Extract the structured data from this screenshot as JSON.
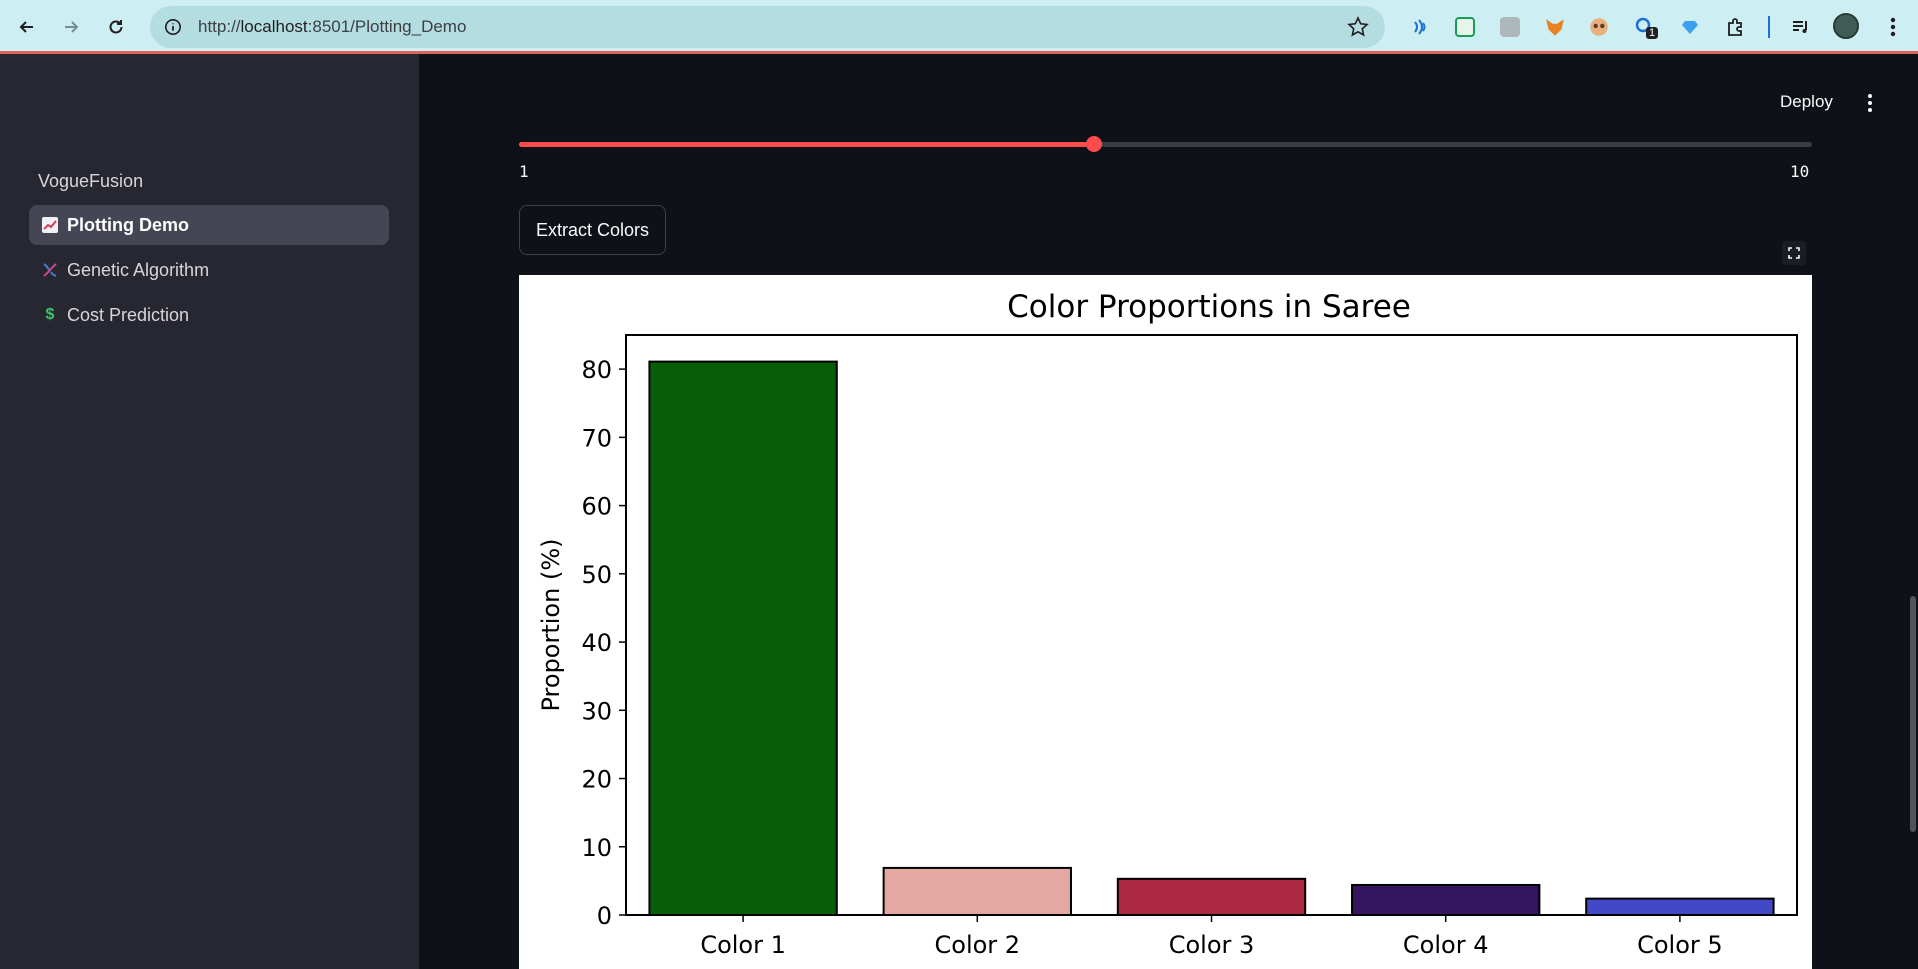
{
  "browser": {
    "url_prefix": "http://",
    "url_host": "localhost",
    "url_rest": ":8501/Plotting_Demo",
    "extension_badge": "1"
  },
  "sidebar": {
    "app_name": "VogueFusion",
    "items": [
      {
        "label": "Plotting Demo",
        "icon": "chart-increasing-icon",
        "active": true
      },
      {
        "label": "Genetic Algorithm",
        "icon": "dna-icon",
        "active": false
      },
      {
        "label": "Cost Prediction",
        "icon": "dollar-icon",
        "active": false
      }
    ]
  },
  "header": {
    "deploy_label": "Deploy"
  },
  "slider": {
    "min_label": "1",
    "max_label": "10",
    "min": 1,
    "max": 10,
    "value": 5,
    "accent": "#ff4b4b"
  },
  "extract_button_label": "Extract Colors",
  "chart_data": {
    "type": "bar",
    "title": "Color Proportions in Saree",
    "xlabel": "",
    "ylabel": "Proportion (%)",
    "categories": [
      "Color 1",
      "Color 2",
      "Color 3",
      "Color 4",
      "Color 5"
    ],
    "values": [
      81.1,
      6.9,
      5.3,
      4.4,
      2.4
    ],
    "colors": [
      "#075e07",
      "#e3a8a2",
      "#ab2840",
      "#361560",
      "#4248c6"
    ],
    "ylim": [
      0,
      85
    ],
    "yticks": [
      0,
      10,
      20,
      30,
      40,
      50,
      60,
      70,
      80
    ],
    "grid": false
  }
}
